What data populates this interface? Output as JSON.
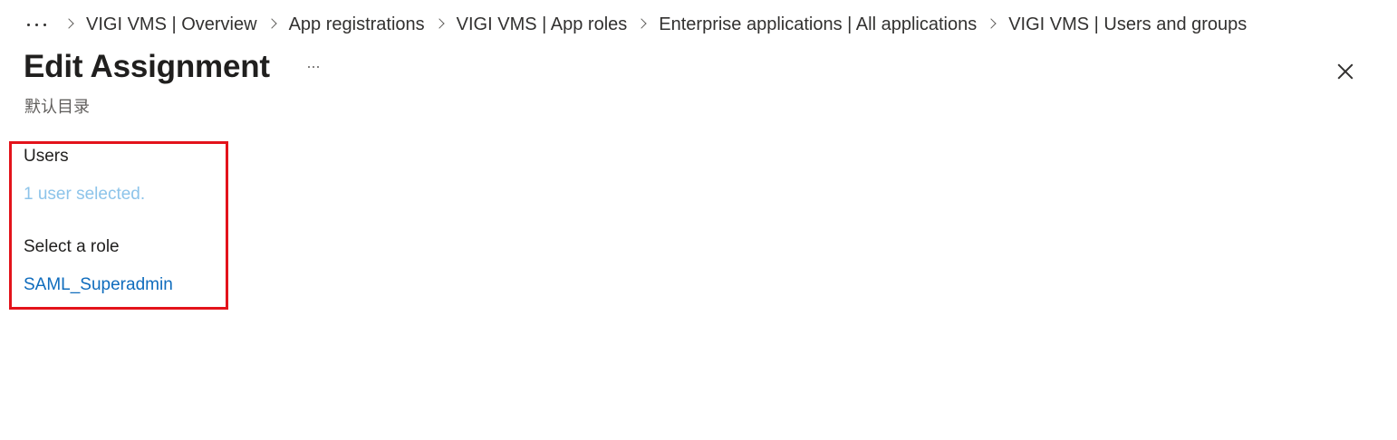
{
  "breadcrumb": {
    "items": [
      {
        "label": "VIGI VMS | Overview"
      },
      {
        "label": "App registrations"
      },
      {
        "label": "VIGI VMS | App roles"
      },
      {
        "label": "Enterprise applications | All applications"
      },
      {
        "label": "VIGI VMS | Users and groups"
      }
    ]
  },
  "header": {
    "title": "Edit Assignment",
    "subtitle": "默认目录"
  },
  "form": {
    "users_label": "Users",
    "users_value": "1 user selected.",
    "role_label": "Select a role",
    "role_value": "SAML_Superadmin"
  },
  "colors": {
    "highlight": "#e3131b",
    "link": "#0f6cbd",
    "disabled_link": "#8dc4ea"
  }
}
